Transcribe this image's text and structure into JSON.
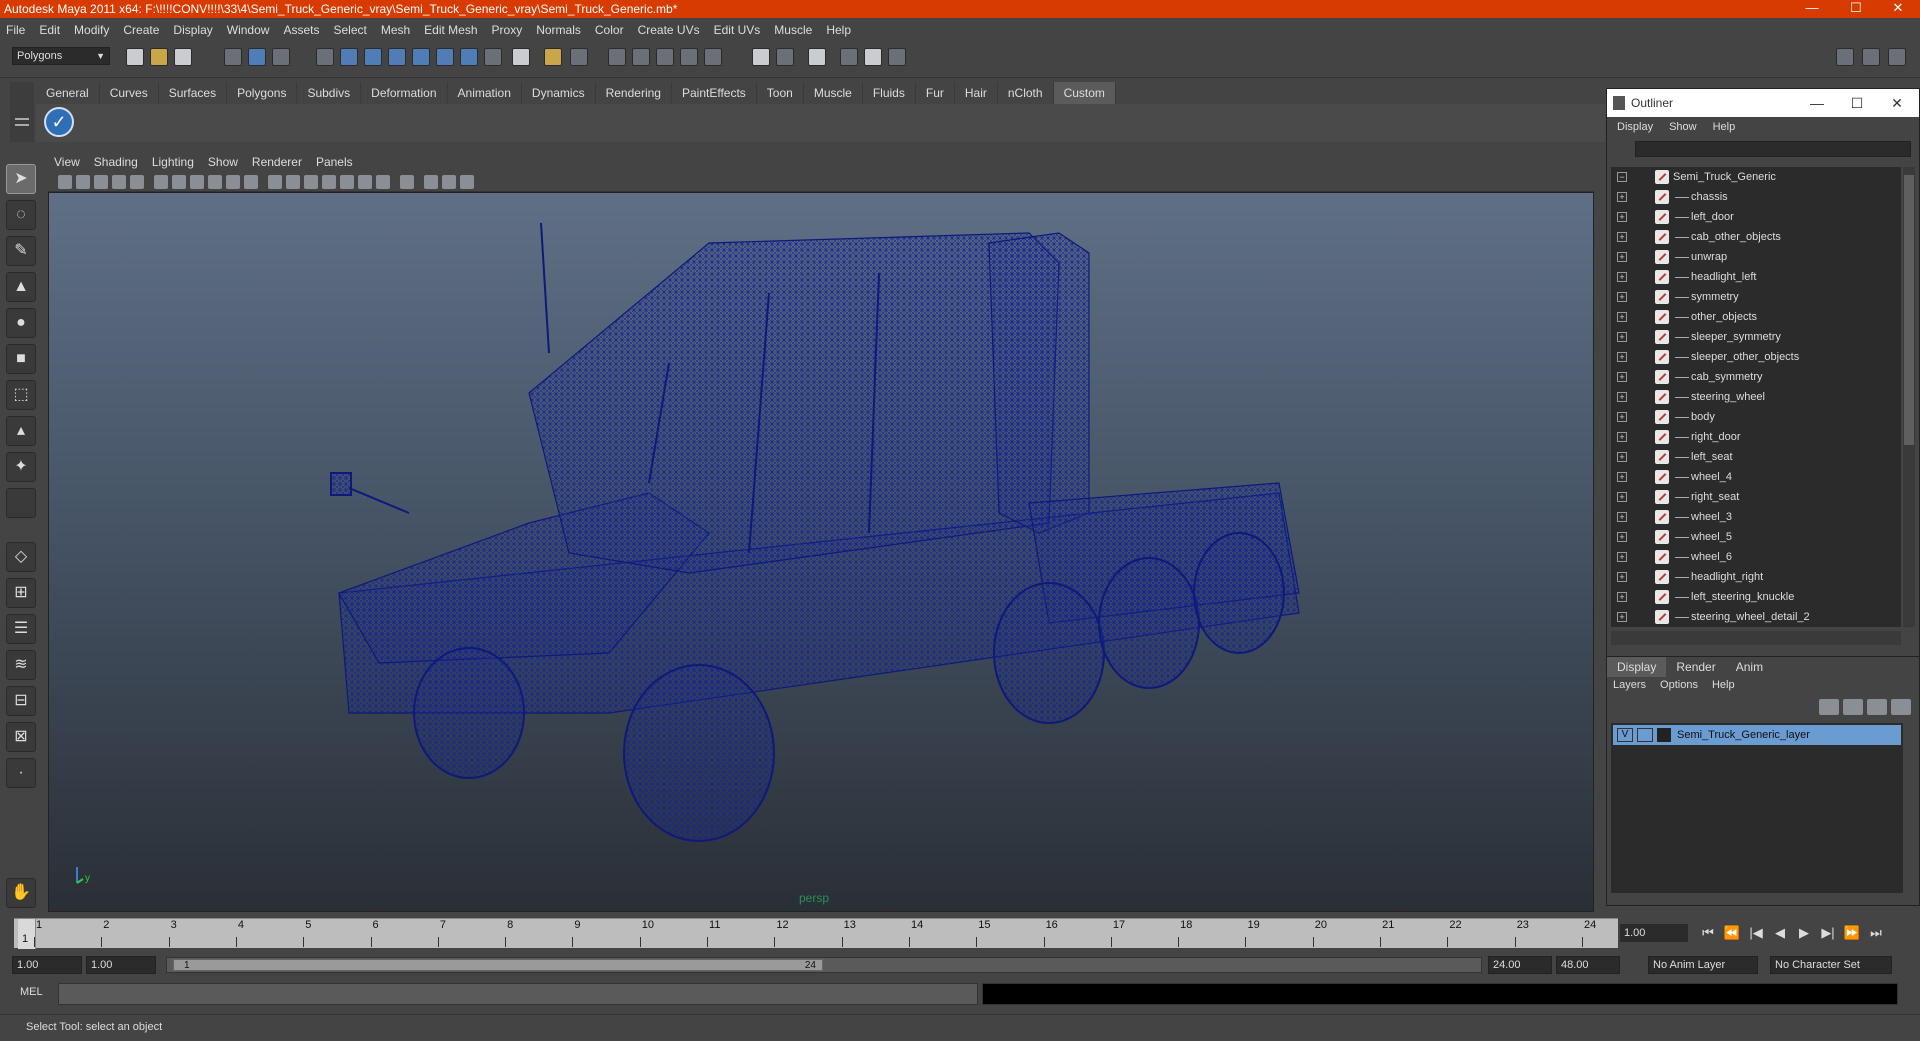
{
  "window": {
    "title": "Autodesk Maya 2011 x64: F:\\!!!!CONV!!!!\\33\\4\\Semi_Truck_Generic_vray\\Semi_Truck_Generic_vray\\Semi_Truck_Generic.mb*",
    "minimize": "—",
    "maximize": "☐",
    "close": "✕"
  },
  "menubar": [
    "File",
    "Edit",
    "Modify",
    "Create",
    "Display",
    "Window",
    "Assets",
    "Select",
    "Mesh",
    "Edit Mesh",
    "Proxy",
    "Normals",
    "Color",
    "Create UVs",
    "Edit UVs",
    "Muscle",
    "Help"
  ],
  "statusline": {
    "mode": "Polygons"
  },
  "shelf": {
    "tabs": [
      "General",
      "Curves",
      "Surfaces",
      "Polygons",
      "Subdivs",
      "Deformation",
      "Animation",
      "Dynamics",
      "Rendering",
      "PaintEffects",
      "Toon",
      "Muscle",
      "Fluids",
      "Fur",
      "Hair",
      "nCloth",
      "Custom"
    ],
    "active": "Custom"
  },
  "viewport": {
    "menu": [
      "View",
      "Shading",
      "Lighting",
      "Show",
      "Renderer",
      "Panels"
    ],
    "camera": "persp",
    "wire_color": "#0d1a7a",
    "axis_y": "y"
  },
  "timeline": {
    "ticks": [
      "1",
      "2",
      "3",
      "4",
      "5",
      "6",
      "7",
      "8",
      "9",
      "10",
      "11",
      "12",
      "13",
      "14",
      "15",
      "16",
      "17",
      "18",
      "19",
      "20",
      "21",
      "22",
      "23",
      "24"
    ],
    "current_marker": "1",
    "current_frame": "1.00"
  },
  "range": {
    "start": "1.00",
    "start_inner": "1.00",
    "handle_left": "1",
    "handle_right": "24",
    "end_inner": "24.00",
    "end": "48.00",
    "anim_layer": "No Anim Layer",
    "char_set": "No Character Set"
  },
  "cmdline": {
    "label": "MEL"
  },
  "helpline": "Select Tool: select an object",
  "outliner": {
    "title": "Outliner",
    "menu": [
      "Display",
      "Show",
      "Help"
    ],
    "root": "Semi_Truck_Generic",
    "items": [
      "chassis",
      "left_door",
      "cab_other_objects",
      "unwrap",
      "headlight_left",
      "symmetry",
      "other_objects",
      "sleeper_symmetry",
      "sleeper_other_objects",
      "cab_symmetry",
      "steering_wheel",
      "body",
      "right_door",
      "left_seat",
      "wheel_4",
      "right_seat",
      "wheel_3",
      "wheel_5",
      "wheel_6",
      "headlight_right",
      "left_steering_knuckle",
      "steering_wheel_detail_2"
    ]
  },
  "layer_editor": {
    "tabs": [
      "Display",
      "Render",
      "Anim"
    ],
    "active": "Display",
    "menu": [
      "Layers",
      "Options",
      "Help"
    ],
    "layer_name": "Semi_Truck_Generic_layer",
    "layer_visibility": "V"
  },
  "playback": [
    "⏮",
    "⏪",
    "|◀",
    "◀",
    "▶",
    "▶|",
    "⏩",
    "⏭"
  ]
}
